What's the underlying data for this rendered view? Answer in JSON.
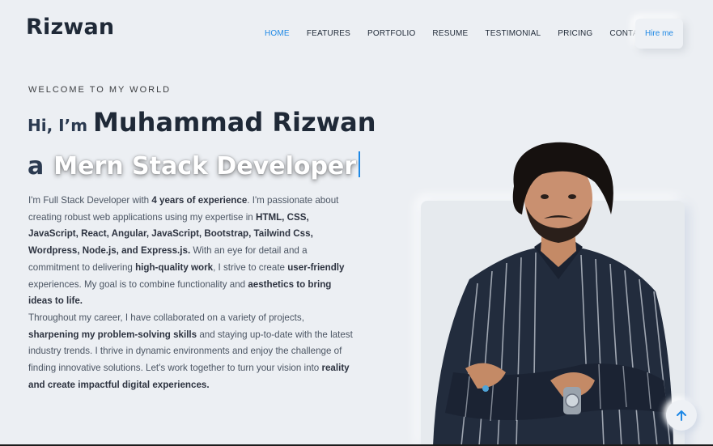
{
  "brand": {
    "logo": "Rizwan"
  },
  "nav": {
    "items": [
      {
        "label": "HOME",
        "active": true
      },
      {
        "label": "FEATURES",
        "active": false
      },
      {
        "label": "PORTFOLIO",
        "active": false
      },
      {
        "label": "RESUME",
        "active": false
      },
      {
        "label": "TESTIMONIAL",
        "active": false
      },
      {
        "label": "PRICING",
        "active": false
      },
      {
        "label": "CONTACT",
        "active": false
      }
    ],
    "hire_label": "Hire me"
  },
  "hero": {
    "welcome": "WELCOME TO MY WORLD",
    "greeting": "Hi, I’m",
    "name": "Muhammad Rizwan",
    "article": "a",
    "role": "Mern Stack Developer",
    "desc": {
      "p1": [
        {
          "t": "I'm Full Stack Developer with ",
          "b": false
        },
        {
          "t": "4 years of experience",
          "b": true
        },
        {
          "t": ". I'm passionate about creating robust web applications using my expertise in ",
          "b": false
        },
        {
          "t": "HTML, CSS, JavaScript, React, Angular, JavaScript, Bootstrap, Tailwind Css, Wordpress, Node.js, and Express.js.",
          "b": true
        },
        {
          "t": " With an eye for detail and a commitment to delivering ",
          "b": false
        },
        {
          "t": "high-quality work",
          "b": true
        },
        {
          "t": ", I strive to create ",
          "b": false
        },
        {
          "t": "user-friendly",
          "b": true
        },
        {
          "t": " experiences. My goal is to combine functionality and ",
          "b": false
        },
        {
          "t": "aesthetics to bring ideas to life.",
          "b": true
        }
      ],
      "p2": [
        {
          "t": "Throughout my career, I have collaborated on a variety of projects, ",
          "b": false
        },
        {
          "t": "sharpening my problem-solving skills",
          "b": true
        },
        {
          "t": " and staying up-to-date with the latest industry trends. I thrive in dynamic environments and enjoy the challenge of finding innovative solutions. Let's work together to turn your vision into ",
          "b": false
        },
        {
          "t": "reality and create impactful digital experiences.",
          "b": true
        }
      ]
    }
  },
  "colors": {
    "accent": "#1e88e5",
    "background": "#eceff3",
    "heading": "#1f2937"
  },
  "icons": {
    "scroll_top": "arrow-up-icon"
  }
}
